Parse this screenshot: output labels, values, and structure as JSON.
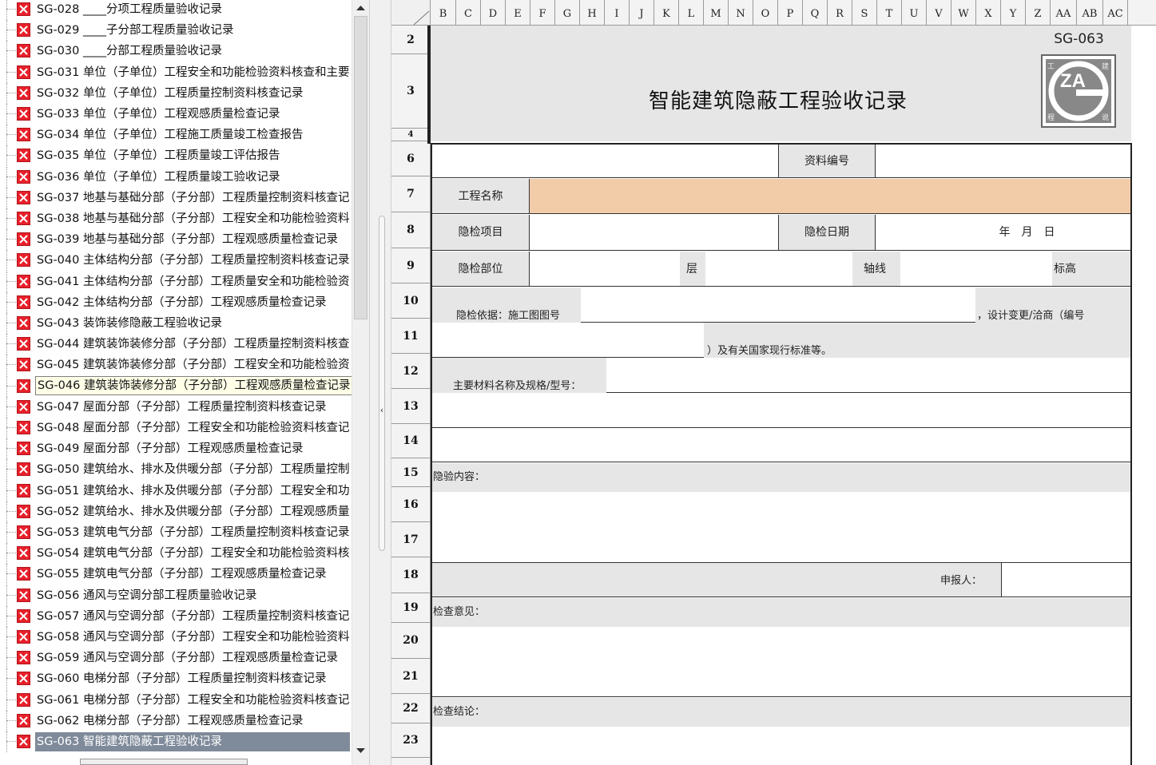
{
  "tree": {
    "items": [
      {
        "label": "SG-028 ____分项工程质量验收记录"
      },
      {
        "label": "SG-029 ____子分部工程质量验收记录"
      },
      {
        "label": "SG-030 ____分部工程质量验收记录"
      },
      {
        "label": "SG-031 单位（子单位）工程安全和功能检验资料核查和主要"
      },
      {
        "label": "SG-032 单位（子单位）工程质量控制资料核查记录"
      },
      {
        "label": "SG-033 单位（子单位）工程观感质量检查记录"
      },
      {
        "label": "SG-034 单位（子单位）工程施工质量竣工检查报告"
      },
      {
        "label": "SG-035 单位（子单位）工程质量竣工评估报告"
      },
      {
        "label": "SG-036 单位（子单位）工程质量竣工验收记录"
      },
      {
        "label": "SG-037 地基与基础分部（子分部）工程质量控制资料核查记"
      },
      {
        "label": "SG-038 地基与基础分部（子分部）工程安全和功能检验资料"
      },
      {
        "label": "SG-039 地基与基础分部（子分部）工程观感质量检查记录"
      },
      {
        "label": "SG-040 主体结构分部（子分部）工程质量控制资料核查记录"
      },
      {
        "label": "SG-041 主体结构分部（子分部）工程质量安全和功能检验资"
      },
      {
        "label": "SG-042 主体结构分部（子分部）工程观感质量检查记录"
      },
      {
        "label": "SG-043 装饰装修隐蔽工程验收记录"
      },
      {
        "label": "SG-044 建筑装饰装修分部（子分部）工程质量控制资料核查"
      },
      {
        "label": "SG-045 建筑装饰装修分部（子分部）工程安全和功能检验资"
      },
      {
        "label": "SG-046 建筑装饰装修分部（子分部）工程观感质量检查记录"
      },
      {
        "label": "SG-047 屋面分部（子分部）工程质量控制资料核查记录"
      },
      {
        "label": "SG-048 屋面分部（子分部）工程安全和功能检验资料核查记"
      },
      {
        "label": "SG-049 屋面分部（子分部）工程观感质量检查记录"
      },
      {
        "label": "SG-050 建筑给水、排水及供暖分部（子分部）工程质量控制"
      },
      {
        "label": "SG-051 建筑给水、排水及供暖分部（子分部）工程安全和功"
      },
      {
        "label": "SG-052 建筑给水、排水及供暖分部（子分部）工程观感质量"
      },
      {
        "label": "SG-053 建筑电气分部（子分部）工程质量控制资料核查记录"
      },
      {
        "label": "SG-054 建筑电气分部（子分部）工程安全和功能检验资料核"
      },
      {
        "label": "SG-055 建筑电气分部（子分部）工程观感质量检查记录"
      },
      {
        "label": "SG-056 通风与空调分部工程质量验收记录"
      },
      {
        "label": "SG-057 通风与空调分部（子分部）工程质量控制资料核查记"
      },
      {
        "label": "SG-058 通风与空调分部（子分部）工程安全和功能检验资料"
      },
      {
        "label": "SG-059 通风与空调分部（子分部）工程观感质量检查记录"
      },
      {
        "label": "SG-060 电梯分部（子分部）工程质量控制资料核查记录"
      },
      {
        "label": "SG-061 电梯分部（子分部）工程安全和功能检验资料核查记"
      },
      {
        "label": "SG-062 电梯分部（子分部）工程观感质量检查记录"
      },
      {
        "label": "SG-063 智能建筑隐蔽工程验收记录"
      }
    ],
    "hover_index": 18,
    "selected_index": 35
  },
  "sheet": {
    "columns": [
      "B",
      "C",
      "D",
      "E",
      "F",
      "G",
      "H",
      "I",
      "J",
      "K",
      "L",
      "M",
      "N",
      "O",
      "P",
      "Q",
      "R",
      "S",
      "T",
      "U",
      "V",
      "W",
      "X",
      "Y",
      "Z",
      "AA",
      "AB",
      "AC"
    ],
    "rows": [
      "2",
      "3",
      "4",
      "6",
      "7",
      "8",
      "9",
      "10",
      "11",
      "12",
      "13",
      "14",
      "15",
      "16",
      "17",
      "18",
      "19",
      "20",
      "21",
      "22",
      "23"
    ],
    "form": {
      "code": "SG-063",
      "title": "智能建筑隐蔽工程验收记录",
      "logo_text": "ZA",
      "logo_corners": [
        "工",
        "建",
        "程",
        "说"
      ],
      "doc_no_label": "资料编号",
      "project_name_label": "工程名称",
      "inspect_item_label": "隐检项目",
      "inspect_date_label": "隐检日期",
      "date_value": "年　月　日",
      "inspect_part_label": "隐检部位",
      "floor_label": "层",
      "axis_label": "轴线",
      "elevation_label": "标高",
      "basis_label": "隐检依据：施工图图号",
      "design_change_label": "，设计变更/洽商（编号",
      "standards_label": "）及有关国家现行标准等。",
      "material_label": "主要材料名称及规格/型号：",
      "content_label": "隐验内容：",
      "reporter_label": "申报人：",
      "opinion_label": "检查意见：",
      "conclusion_label": "检查结论："
    }
  },
  "colors": {
    "icon_red": "#e8202a",
    "peach": "#f2cba8",
    "gray_cell": "#e6e6e6",
    "selected": "#7f8a9a"
  }
}
